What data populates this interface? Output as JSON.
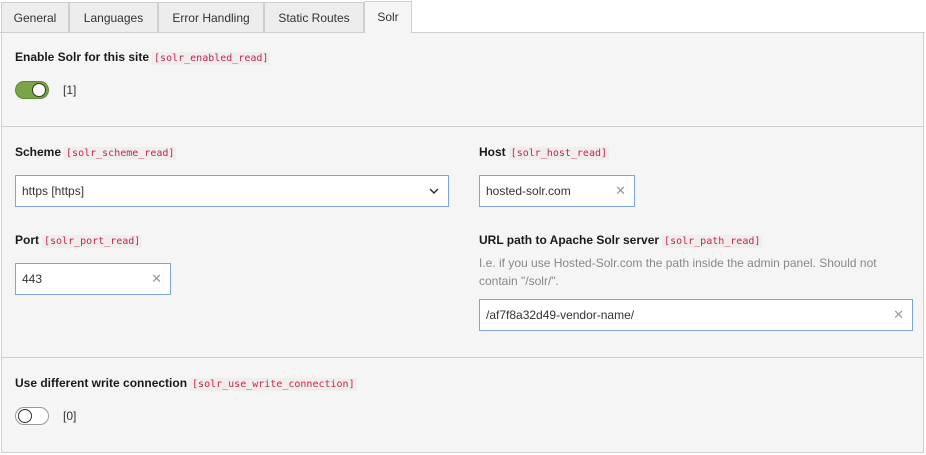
{
  "tabs": [
    {
      "label": "General"
    },
    {
      "label": "Languages"
    },
    {
      "label": "Error Handling"
    },
    {
      "label": "Static Routes"
    },
    {
      "label": "Solr"
    }
  ],
  "active_tab": "Solr",
  "enable": {
    "label": "Enable Solr for this site",
    "code": "[solr_enabled_read]",
    "toggle_state": "on",
    "value": "[1]"
  },
  "scheme": {
    "label": "Scheme",
    "code": "[solr_scheme_read]",
    "value": "https [https]"
  },
  "host": {
    "label": "Host",
    "code": "[solr_host_read]",
    "value": "hosted-solr.com"
  },
  "port": {
    "label": "Port",
    "code": "[solr_port_read]",
    "value": "443"
  },
  "path": {
    "label": "URL path to Apache Solr server",
    "code": "[solr_path_read]",
    "help_line1": "I.e. if you use Hosted-Solr.com the path inside the admin panel. Should not",
    "help_line2": "contain \"/solr/\".",
    "value": "/af7f8a32d49-vendor-name/"
  },
  "write_connection": {
    "label": "Use different write connection",
    "code": "[solr_use_write_connection]",
    "toggle_state": "off",
    "value": "[0]"
  },
  "colors": {
    "toggle_on": "#79a548",
    "code_text": "#c7254e",
    "field_border": "#7fa7d6"
  },
  "icons": {
    "clear": "close-icon",
    "select": "chevron-down-icon"
  }
}
